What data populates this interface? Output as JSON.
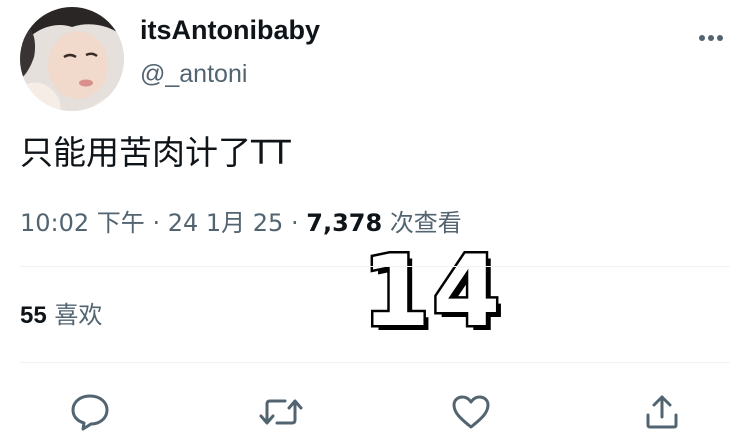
{
  "user": {
    "display_name": "itsAntonibaby",
    "handle": "@_antoni"
  },
  "tweet": {
    "text": "只能用苦肉计了TT",
    "time": "10:02 下午",
    "separator": "·",
    "date": "24 1月 25",
    "views_count": "7,378",
    "views_label": "次查看"
  },
  "stats": {
    "likes_count": "55",
    "likes_label": "喜欢"
  },
  "overlay": {
    "number": "14"
  },
  "icons": {
    "more": "more-horizontal-icon",
    "reply": "reply-bubble-icon",
    "retweet": "retweet-icon",
    "like": "heart-icon",
    "share": "share-arrow-icon"
  },
  "colors": {
    "text_primary": "#0f1419",
    "text_secondary": "#536471",
    "divider": "#eff3f4",
    "background": "#ffffff"
  }
}
